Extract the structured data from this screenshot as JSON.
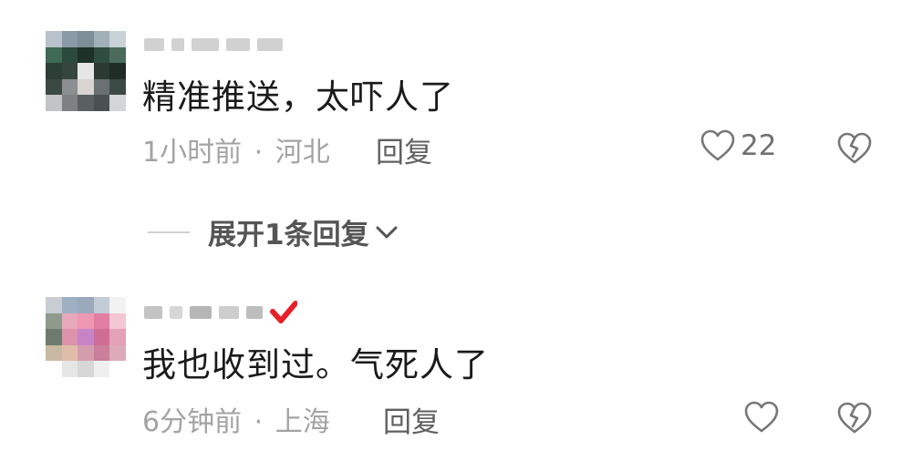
{
  "comments": [
    {
      "text": "精准推送，太吓人了",
      "time": "1小时前",
      "separator": "·",
      "location": "河北",
      "reply_label": "回复",
      "likes": "22",
      "like_icon": "heart-outline-icon",
      "dislike_icon": "broken-heart-icon"
    },
    {
      "text": "我也收到过。气死人了",
      "time": "6分钟前",
      "separator": "·",
      "location": "上海",
      "reply_label": "回复",
      "likes": "",
      "like_icon": "heart-outline-icon",
      "dislike_icon": "broken-heart-icon",
      "badge_icon": "red-checkmark-badge-icon"
    }
  ],
  "expand_replies": {
    "label": "展开1条回复"
  },
  "colors": {
    "text": "#1a1a1a",
    "meta": "#a3a3a3",
    "badge": "#e8202a"
  }
}
